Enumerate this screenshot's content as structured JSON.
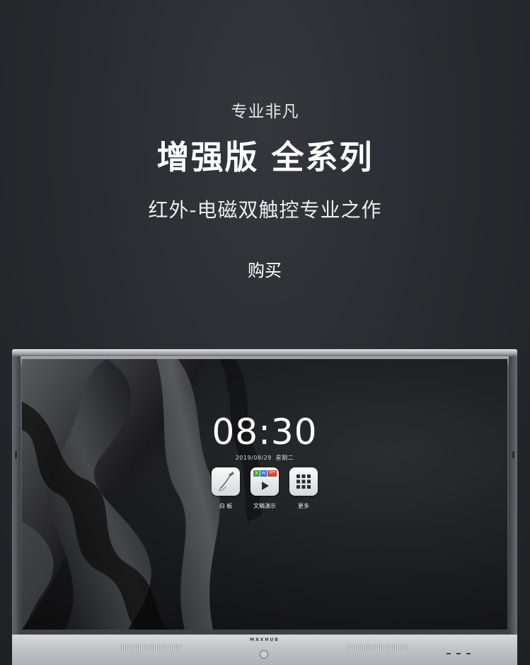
{
  "hero": {
    "eyebrow": "专业非凡",
    "title": "增强版 全系列",
    "subtitle": "红外-电磁双触控专业之作",
    "buy_label": "购买"
  },
  "screen": {
    "time": "08:30",
    "date": "2019/08/29",
    "weekday": "星期二",
    "apps": [
      {
        "label": "白 板",
        "icon": "whiteboard-pen-icon"
      },
      {
        "label": "文稿演示",
        "icon": "presentation-icon"
      },
      {
        "label": "更多",
        "icon": "apps-grid-icon"
      }
    ],
    "presentation_badges": [
      "X",
      "W",
      "PPT"
    ]
  },
  "device": {
    "brand": "MAXHUB"
  },
  "colors": {
    "background": "#2a2c31",
    "text": "#ffffff",
    "bezel": "#c4c6ca",
    "badge_green": "#3aa845",
    "badge_blue": "#2f6fd1",
    "badge_red": "#d64533"
  }
}
